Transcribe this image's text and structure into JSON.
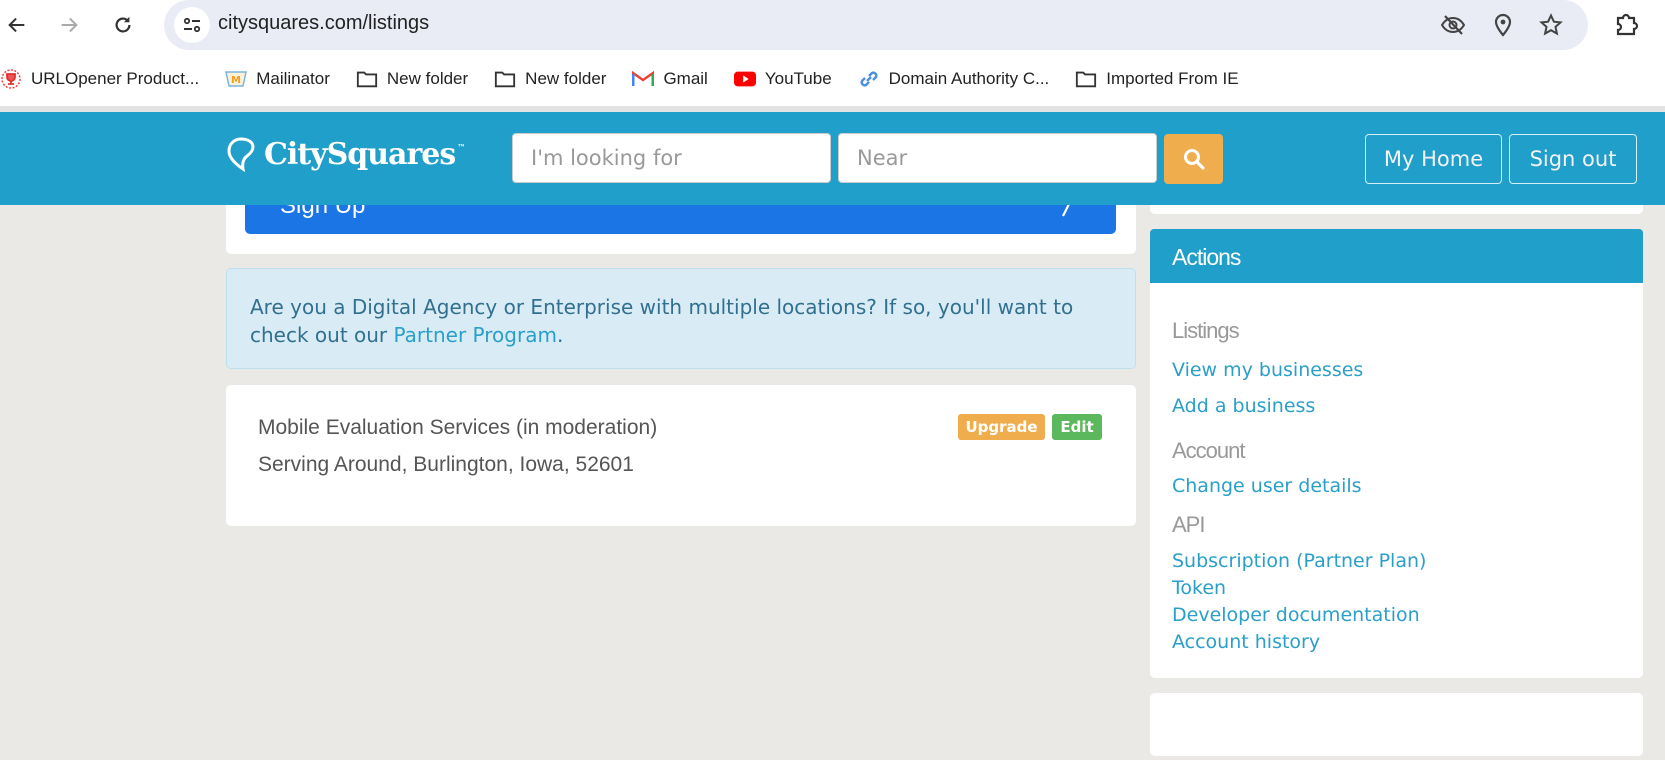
{
  "browser": {
    "url": "citysquares.com/listings",
    "bookmarks": [
      {
        "label": "URLOpener Product...",
        "icon": "trophy-icon"
      },
      {
        "label": "Mailinator",
        "icon": "mailinator-icon"
      },
      {
        "label": "New folder",
        "icon": "folder-icon"
      },
      {
        "label": "New folder",
        "icon": "folder-icon"
      },
      {
        "label": "Gmail",
        "icon": "gmail-icon"
      },
      {
        "label": "YouTube",
        "icon": "youtube-icon"
      },
      {
        "label": "Domain Authority C...",
        "icon": "link-icon"
      },
      {
        "label": "Imported From IE",
        "icon": "folder-icon"
      }
    ]
  },
  "header": {
    "logo": "CitySquares",
    "logo_tm": "™",
    "search_placeholder": "I'm looking for",
    "near_placeholder": "Near",
    "my_home": "My Home",
    "sign_out": "Sign out",
    "accent": "#209fca",
    "search_color": "#f0ad4e"
  },
  "main": {
    "signup_label": "Sign Up",
    "info_text": "Are you a Digital Agency or Enterprise with multiple locations? If so, you'll want to check out our ",
    "info_link": "Partner Program",
    "info_end": ".",
    "listing": {
      "name": "Mobile Evaluation Services (in moderation)",
      "address": "Serving Around, Burlington, Iowa, 52601",
      "upgrade": "Upgrade",
      "edit": "Edit"
    }
  },
  "sidebar": {
    "title": "Actions",
    "sections": [
      {
        "title": "Listings",
        "links": [
          "View my businesses",
          "Add a business"
        ]
      },
      {
        "title": "Account",
        "links": [
          "Change user details"
        ]
      },
      {
        "title": "API",
        "links": [
          "Subscription (Partner Plan)",
          "Token",
          "Developer documentation",
          "Account history"
        ]
      }
    ]
  }
}
